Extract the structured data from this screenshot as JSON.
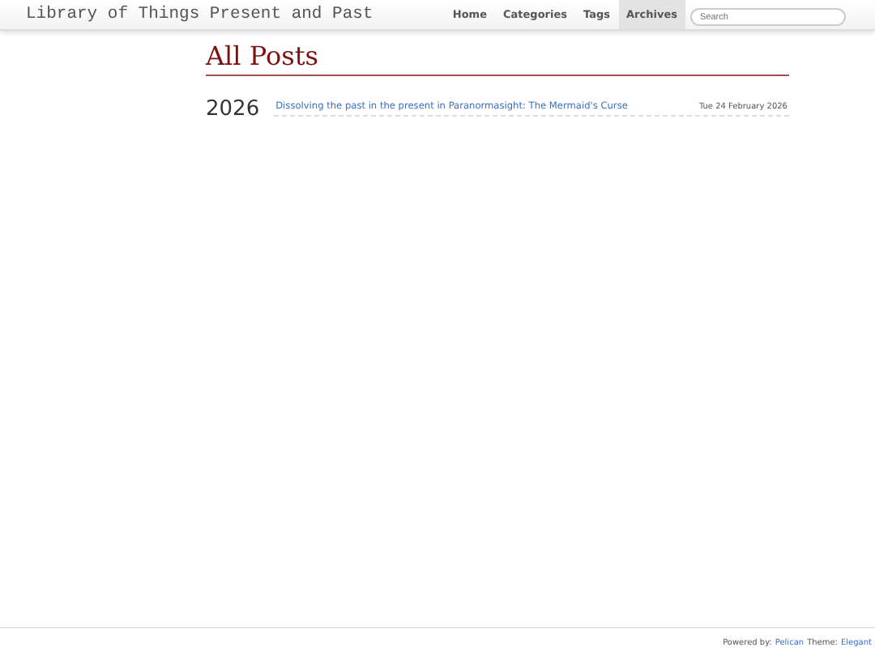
{
  "navbar": {
    "brand": "Library of Things Present and Past",
    "links": [
      {
        "label": "Home",
        "selected": false
      },
      {
        "label": "Categories",
        "selected": false
      },
      {
        "label": "Tags",
        "selected": false
      },
      {
        "label": "Archives",
        "selected": true
      }
    ],
    "search": {
      "placeholder": "Search"
    }
  },
  "page": {
    "title": "All Posts",
    "years": [
      {
        "year": "2026",
        "posts": [
          {
            "title": "Dissolving the past in the present in Paranormasight: The Mermaid's Curse",
            "date": "Tue 24 February 2026"
          }
        ]
      }
    ]
  },
  "footer": {
    "prefix": "Powered by:",
    "link1": "Pelican",
    "middle": "Theme:",
    "link2": "Elegant"
  }
}
